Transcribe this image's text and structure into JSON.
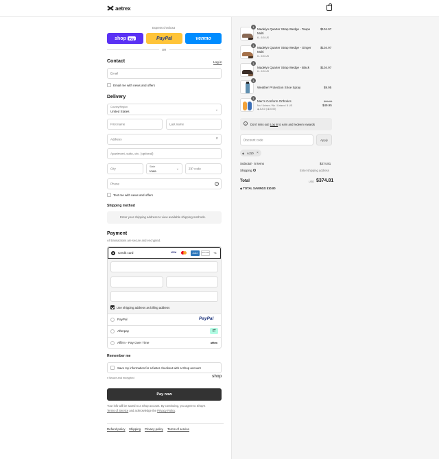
{
  "header": {
    "brand": "aetrex"
  },
  "express": {
    "title": "Express checkout",
    "shop_pay": "shop",
    "shop_pay_badge": "Pay",
    "paypal": "PayPal",
    "venmo": "venmo",
    "or": "OR"
  },
  "contact": {
    "title": "Contact",
    "login": "Log in",
    "email_placeholder": "Email",
    "email_news": "Email me with news and offers"
  },
  "delivery": {
    "title": "Delivery",
    "country_label": "Country/Region",
    "country_value": "United States",
    "first_name": "First name",
    "last_name": "Last name",
    "address": "Address",
    "apartment": "Apartment, suite, etc. (optional)",
    "city": "City",
    "state_label": "State",
    "state_value": "Iowa",
    "zip": "ZIP code",
    "phone": "Phone",
    "text_news": "Text me with news and offers"
  },
  "shipping": {
    "title": "Shipping method",
    "note": "Enter your shipping address to view available shipping methods."
  },
  "payment": {
    "title": "Payment",
    "subtitle": "All transactions are secure and encrypted.",
    "credit_card": "Credit card",
    "cards": [
      "VISA",
      "MC",
      "AMEX",
      "DISCOVER"
    ],
    "more_cards": "+4",
    "billing_same": "Use shipping address as billing address",
    "paypal": "PayPal",
    "paypal_logo": "PayPal",
    "afterpay": "Afterpay",
    "affirm": "Affirm - Pay Over Time",
    "affirm_logo": "affirm"
  },
  "remember": {
    "title": "Remember me",
    "save_info": "Save my information for a faster checkout with a Shop account",
    "secure": "Secure and encrypted",
    "shop_logo": "shop"
  },
  "pay_now": "Pay now",
  "legal": {
    "line1": "Your info will be saved to a Shop account. By continuing, you agree to Shop's",
    "terms": "Terms of Service",
    "and_ack": "and acknowledge the",
    "privacy": "Privacy Policy",
    "dot": "."
  },
  "footer_links": [
    "Refund policy",
    "Shipping",
    "Privacy policy",
    "Terms of service"
  ],
  "cart": {
    "items": [
      {
        "qty": "1",
        "name_l1": "Madelyn Quarter Strap Wedge - Taupe",
        "name_l2": "Multi",
        "variant": "6 - 6.5 US",
        "price": "$104.97"
      },
      {
        "qty": "1",
        "name_l1": "Madelyn Quarter Strap Wedge - Ginger",
        "name_l2": "Multi",
        "variant": "6 - 6.5 US",
        "price": "$104.97"
      },
      {
        "qty": "1",
        "name_l1": "Madelyn Quarter Strap Wedge - Black",
        "variant": "6 - 6.5 US",
        "price": "$104.97"
      },
      {
        "qty": "1",
        "name_l1": "Weather Protection Shoe Spray",
        "price": "$9.95"
      },
      {
        "qty": "1",
        "name_l1": "Men's Conform Orthotics",
        "variant": "No / Unisex / No / Unisex / 8 US",
        "discount": "AJ10 (-$10.00)",
        "old_price": "$59.95",
        "price": "$49.95"
      }
    ],
    "notice": "Don't miss out!",
    "notice_link": "Log in",
    "notice_rest": "to earn and redeem rewards",
    "discount_placeholder": "Discount code",
    "apply": "Apply",
    "applied_code": "AJ10",
    "subtotal_label": "Subtotal · 5 items",
    "subtotal_value": "$374.81",
    "shipping_label": "Shipping",
    "shipping_value": "Enter shipping address",
    "total_label": "Total",
    "currency": "USD",
    "total_value": "$374.81",
    "savings_label": "TOTAL SAVINGS",
    "savings_value": "$10.00"
  },
  "colors": {
    "shop_pay": "#5a31f4",
    "paypal": "#ffc439",
    "venmo": "#008cff",
    "pay_now": "#333333"
  }
}
